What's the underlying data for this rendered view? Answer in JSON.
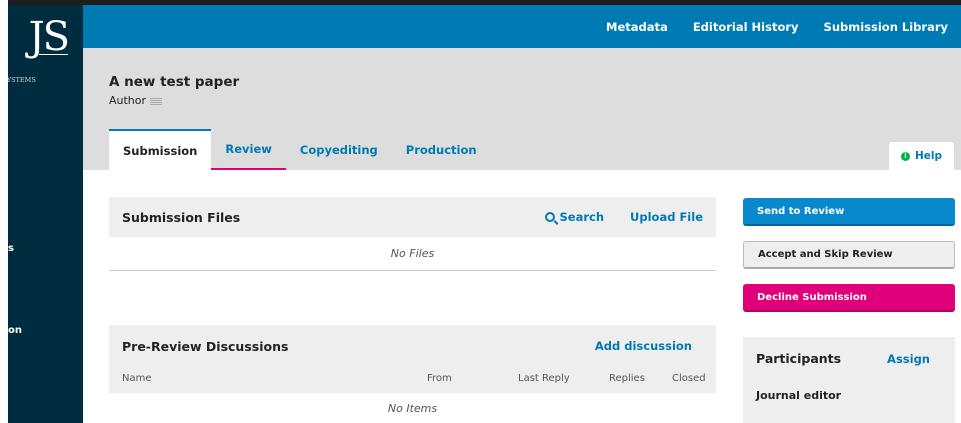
{
  "sidebar": {
    "logo_mark": "JS",
    "logo_subtitle": "L SYSTEMS",
    "nav_stubs": [
      "s",
      "on"
    ]
  },
  "topnav": {
    "items": [
      "Metadata",
      "Editorial History",
      "Submission Library"
    ]
  },
  "submission": {
    "title": "A new test paper",
    "author_label": "Author"
  },
  "tabs": [
    "Submission",
    "Review",
    "Copyediting",
    "Production"
  ],
  "help": {
    "label": "Help",
    "icon": "info-icon"
  },
  "files_panel": {
    "title": "Submission Files",
    "search_label": "Search",
    "upload_label": "Upload File",
    "empty_text": "No Files"
  },
  "discussions_panel": {
    "title": "Pre-Review Discussions",
    "add_label": "Add discussion",
    "columns": [
      "Name",
      "From",
      "Last Reply",
      "Replies",
      "Closed"
    ],
    "empty_text": "No Items"
  },
  "actions": {
    "send_to_review": "Send to Review",
    "accept_skip": "Accept and Skip Review",
    "decline": "Decline Submission"
  },
  "participants": {
    "title": "Participants",
    "assign_label": "Assign",
    "roles": [
      "Journal editor"
    ]
  },
  "colors": {
    "primary": "#007ab2",
    "sidebar": "#002c40",
    "decline": "#e0007a",
    "header_bg": "#dddddd"
  }
}
